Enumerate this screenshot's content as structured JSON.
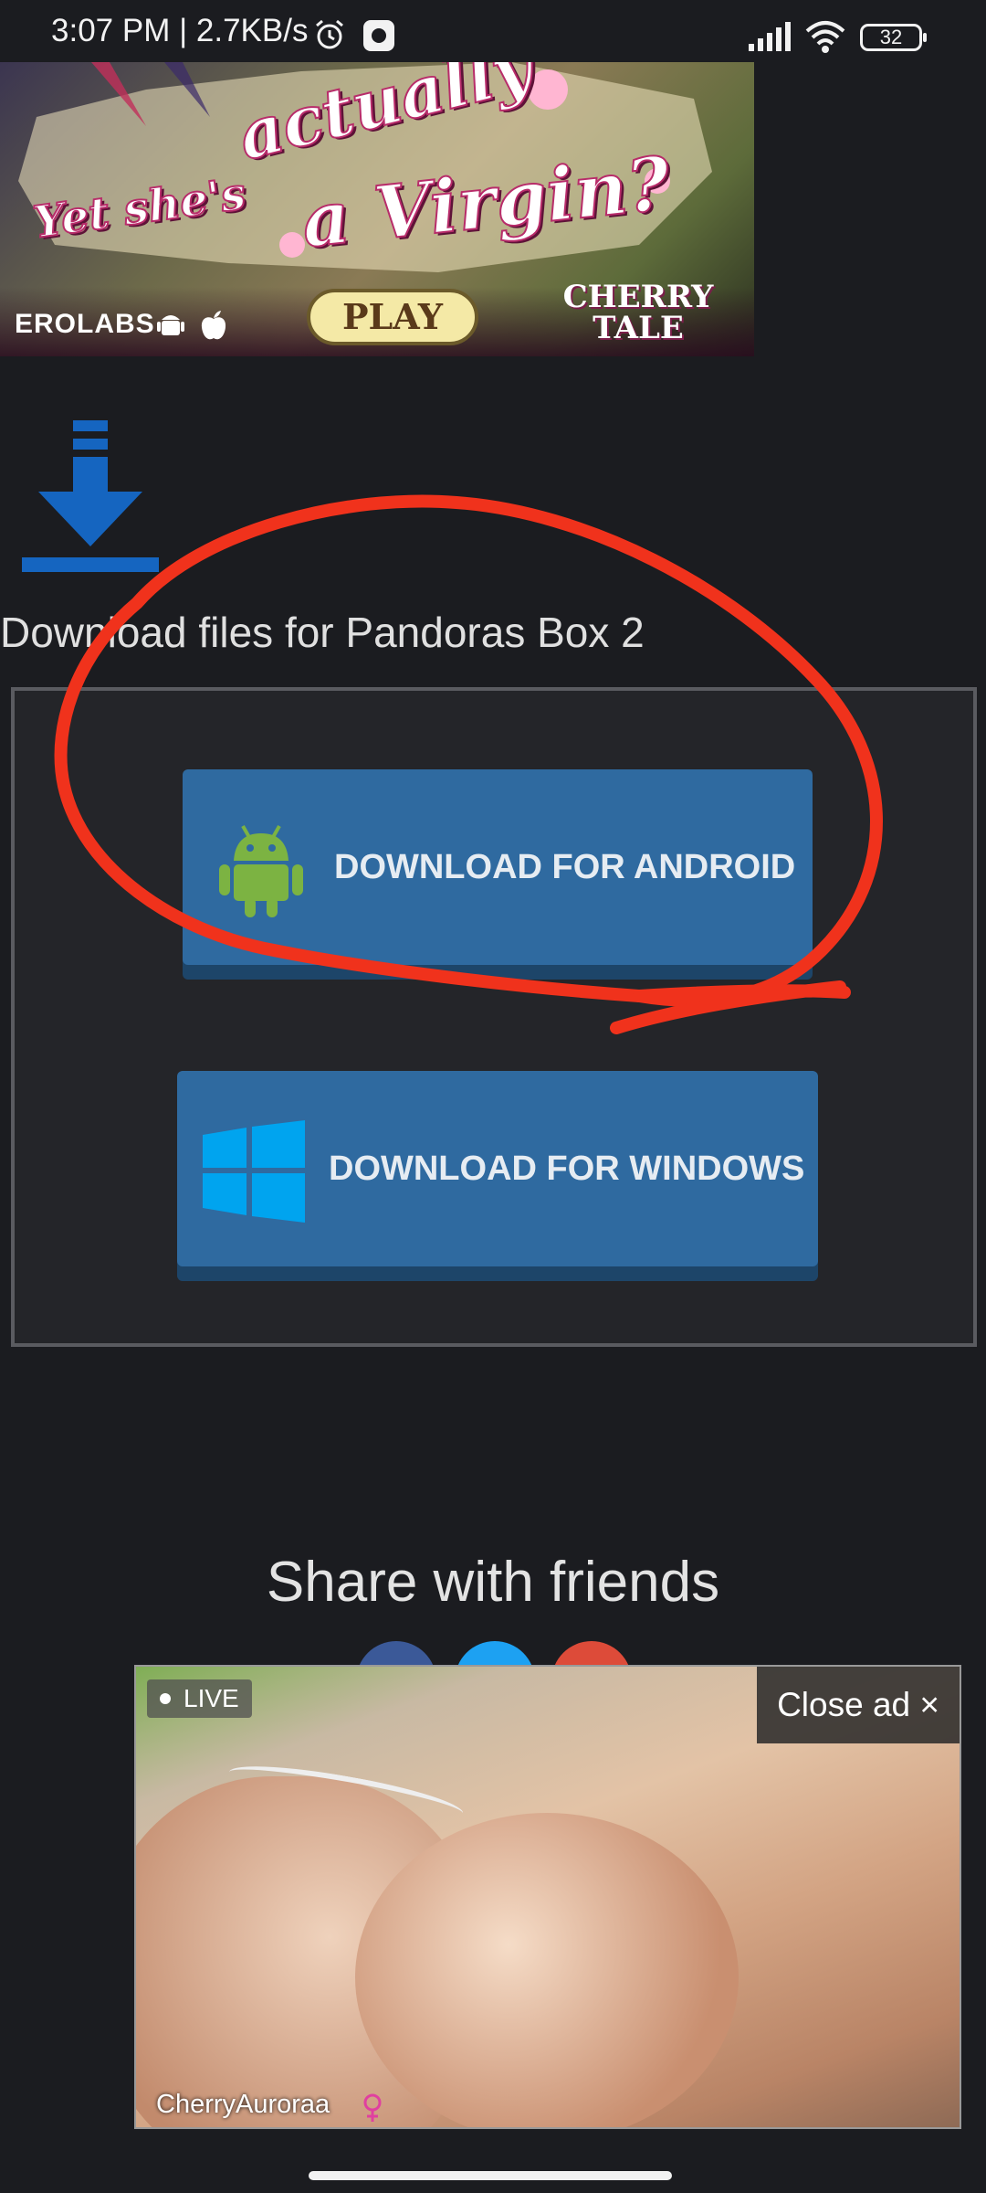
{
  "status_bar": {
    "time": "3:07 PM | 2.7KB/s",
    "battery": "32"
  },
  "top_ad": {
    "line1": "actually",
    "line2": "Yet she's",
    "line3": "a Virgin?",
    "brand": "EROLABS",
    "play_label": "PLAY",
    "logo_line1": "CHERRY",
    "logo_line2": "TALE"
  },
  "download": {
    "heading": "Download files for Pandoras Box 2",
    "android_label": "DOWNLOAD FOR ANDROID",
    "windows_label": "DOWNLOAD FOR WINDOWS"
  },
  "share": {
    "title": "Share with friends"
  },
  "video_ad": {
    "live_label": "LIVE",
    "close_label": "Close ad ×",
    "streamer": "CherryAuroraa"
  },
  "colors": {
    "background": "#1b1c20",
    "button_blue": "#2f6aa0",
    "annotation_red": "#f0321c",
    "android_green": "#7cb342",
    "windows_blue": "#00a4ef",
    "download_icon_blue": "#1565c0"
  }
}
